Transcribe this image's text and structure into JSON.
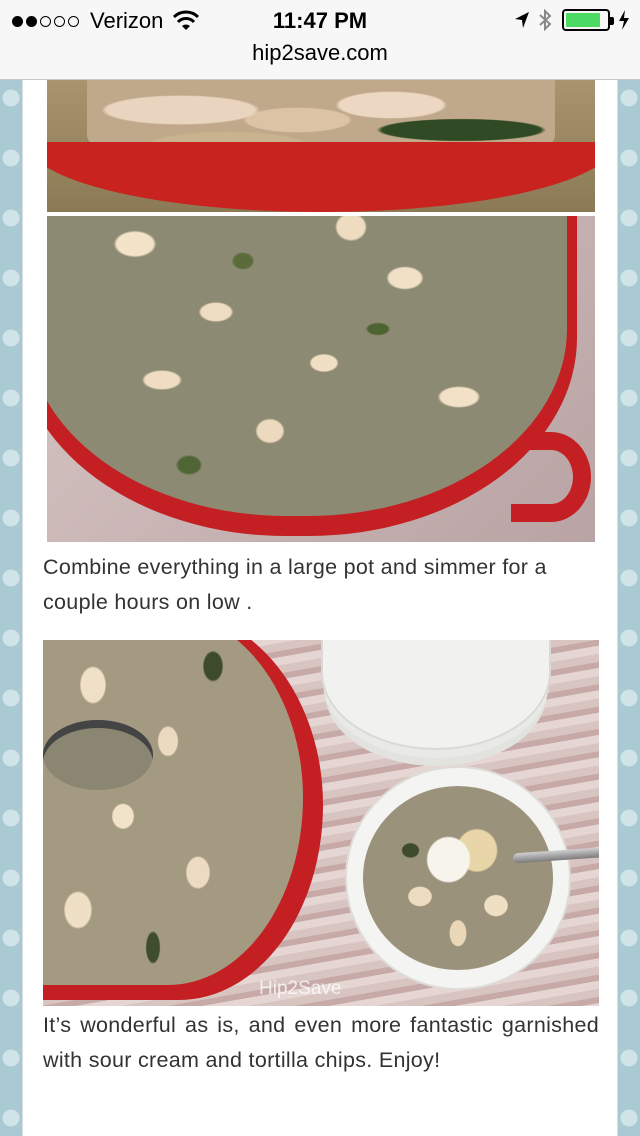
{
  "status_bar": {
    "carrier": "Verizon",
    "signal_bars_filled": 2,
    "signal_bars_total": 5,
    "time": "11:47 PM",
    "battery_level": 0.85
  },
  "address_bar": {
    "url": "hip2save.com"
  },
  "article": {
    "caption_1": "Combine everything in a large pot and simmer for a couple hours on low .",
    "caption_2": "It’s wonderful as is, and even more fantastic garnished with sour cream and tortilla chips. Enjoy!",
    "watermark": "Hip2Save"
  },
  "colors": {
    "page_background": "#a9c9d3",
    "battery_fill": "#4cd964",
    "pot_red": "#c41f22",
    "caption_text": "#333333"
  },
  "icons": [
    "wifi-icon",
    "location-arrow-icon",
    "bluetooth-icon",
    "battery-icon",
    "charging-bolt-icon"
  ]
}
